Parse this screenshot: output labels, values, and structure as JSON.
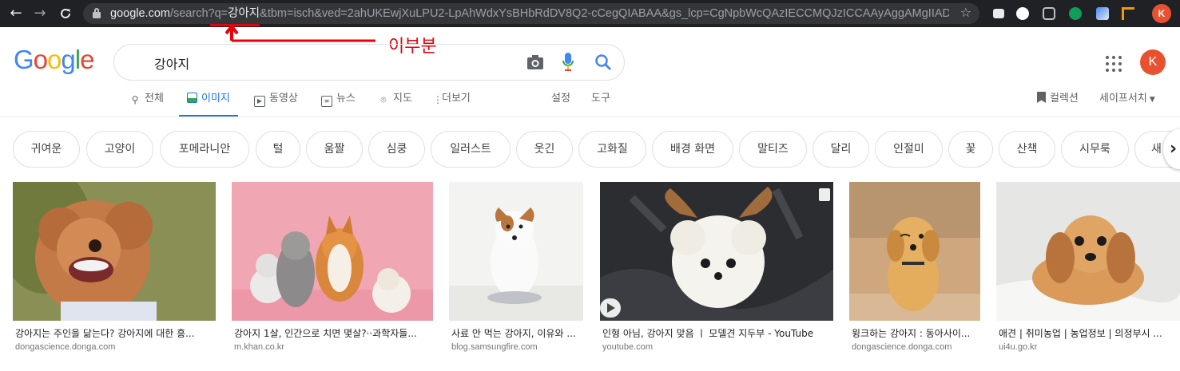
{
  "browser": {
    "url_host": "google.com",
    "url_rest_1": "/search?q=",
    "url_query": "강아지",
    "url_rest_2": "&tbm=isch&ved=2ahUKEwjXuLPU2-LpAhWdxYsBHbRdDV8Q2-cCegQIABAA&gs_lcp=CgNpbWcQAzIECCMQJzICCAAyAggAMgIIADICC...",
    "profile_initial": "K",
    "icons": [
      "back-arrow-icon",
      "forward-arrow-icon",
      "reload-icon",
      "lock-icon",
      "star-icon"
    ]
  },
  "annotation": {
    "text": "이부분",
    "color": "#e8000b"
  },
  "google": {
    "logo_letters": [
      "G",
      "o",
      "o",
      "g",
      "l",
      "e"
    ],
    "logo_colors": [
      "#4285f4",
      "#ea4335",
      "#fbbc05",
      "#4285f4",
      "#34a853",
      "#ea4335"
    ],
    "query": "강아지",
    "avatar_initial": "K"
  },
  "tabs": [
    {
      "label": "전체",
      "icon": "search-icon",
      "active": false
    },
    {
      "label": "이미지",
      "icon": "image-icon",
      "active": true
    },
    {
      "label": "동영상",
      "icon": "video-icon",
      "active": false
    },
    {
      "label": "뉴스",
      "icon": "news-icon",
      "active": false
    },
    {
      "label": "지도",
      "icon": "map-pin-icon",
      "active": false
    },
    {
      "label": "더보기",
      "icon": "more-vert-icon",
      "active": false
    },
    {
      "label": "설정",
      "active": false
    },
    {
      "label": "도구",
      "active": false
    }
  ],
  "right_tools": {
    "collections": "컬렉션",
    "safesearch": "세이프서치"
  },
  "chips": [
    "귀여운",
    "고양이",
    "포메라니안",
    "털",
    "움짤",
    "심쿵",
    "일러스트",
    "웃긴",
    "고화질",
    "배경 화면",
    "말티즈",
    "달리",
    "인절미",
    "꽃",
    "산책",
    "시무룩",
    "새"
  ],
  "results": [
    {
      "caption": "강아지는 주인을 닮는다? 강아지에 대한 흥...",
      "source": "dongascience.donga.com"
    },
    {
      "caption": "강아지 1살, 인간으로 치면 몇살?··과학자들...",
      "source": "m.khan.co.kr"
    },
    {
      "caption": "사료 안 먹는 강아지, 이유와 ...",
      "source": "blog.samsungfire.com"
    },
    {
      "caption": "인형 아님, 강아지 맞음 ㅣ 모델견 지두부 - YouTube",
      "source": "youtube.com"
    },
    {
      "caption": "윙크하는 강아지 : 동아사이...",
      "source": "dongascience.donga.com"
    },
    {
      "caption": "애견 | 취미농업 | 농업정보 | 의정부시 ...",
      "source": "ui4u.go.kr"
    }
  ]
}
